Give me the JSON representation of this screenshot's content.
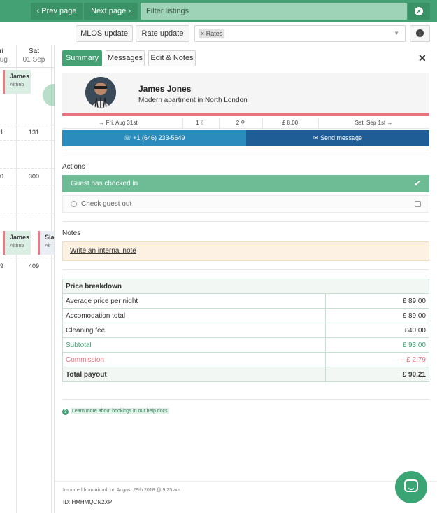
{
  "topbar": {
    "prev_label": "‹ Prev page",
    "next_label": "Next page ›",
    "filter_placeholder": "Filter listings",
    "clear_icon": "×"
  },
  "toolbar": {
    "mlos_label": "MLOS update",
    "rate_label": "Rate update",
    "rates_tag": "× Rates",
    "caret": "▼",
    "info_icon": "i"
  },
  "calendar": {
    "days": [
      {
        "weekday": "ri",
        "date": "Aug"
      },
      {
        "weekday": "Sat",
        "date": "01 Sep"
      }
    ],
    "numbers": [
      "1",
      "131",
      "0",
      "300",
      "9",
      "409"
    ],
    "bookings": [
      {
        "name": "James J",
        "source": "Airbnb"
      },
      {
        "name": "James J",
        "source": "Airbnb"
      },
      {
        "name": "Siar",
        "source": "Air"
      }
    ]
  },
  "panel": {
    "tabs": [
      "Summary",
      "Messages",
      "Edit & Notes"
    ],
    "close_icon": "✕",
    "guest": {
      "name": "James Jones",
      "description": "Modern apartment in North London"
    },
    "meta": {
      "checkin": "→ Fri, Aug 31st",
      "nights": "1 ☾",
      "guests": "2 ⚲",
      "price": "£ 8.00",
      "checkout": "Sat, Sep 1st →"
    },
    "call_label": "☏ +1 (646) 233-5649",
    "message_label": "✉ Send message",
    "actions_label": "Actions",
    "checked_in_label": "Guest has checked in",
    "checkmark": "✔",
    "checkout_label": "Check guest out",
    "notes_label": "Notes",
    "note_link": "Write an internal note",
    "price": {
      "header": "Price breakdown",
      "rows": [
        {
          "label": "Average price per night",
          "amount": "£ 89.00"
        },
        {
          "label": "Accomodation total",
          "amount": "£ 89.00"
        },
        {
          "label": "Cleaning fee",
          "amount": "£40.00"
        },
        {
          "label": "Subtotal",
          "amount": "£ 93.00"
        },
        {
          "label": "Commission",
          "amount": "– £ 2.79"
        },
        {
          "label": "Total payout",
          "amount": "£ 90.21"
        }
      ]
    },
    "help_icon": "?",
    "help_text": "Learn more about bookings in our help docs",
    "imported_text": "Imported from Airbnb on August 29th 2018 @ 9:25 am",
    "booking_id": "ID: HMHMQCN2XP"
  },
  "colors": {
    "brand_green": "#43a173",
    "pink": "#e7737f",
    "call_blue": "#2a8cbc",
    "message_blue": "#1f5d96"
  },
  "icons": [
    "chevron-left-icon",
    "chevron-right-icon",
    "clear-icon",
    "info-icon",
    "close-icon",
    "phone-icon",
    "chat-icon",
    "check-icon",
    "clock-icon",
    "help-icon",
    "moon-icon",
    "person-icon",
    "messenger-icon"
  ]
}
